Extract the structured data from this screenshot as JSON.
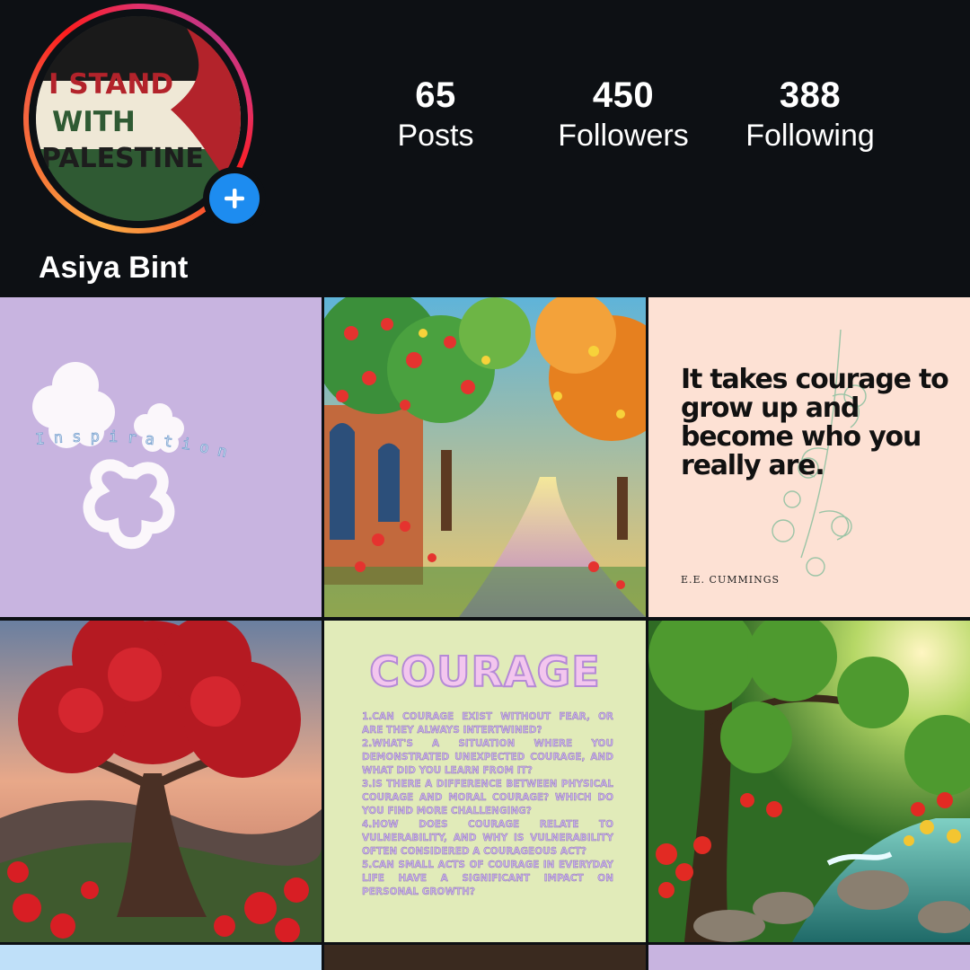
{
  "profile": {
    "username": "Asiya Bint",
    "avatar_text": [
      "I STAND",
      "WITH",
      "PALESTINE"
    ],
    "add_story_icon": "plus-icon"
  },
  "stats": [
    {
      "value": "65",
      "label": "Posts"
    },
    {
      "value": "450",
      "label": "Followers"
    },
    {
      "value": "388",
      "label": "Following"
    }
  ],
  "colors": {
    "background": "#0d1014",
    "accent_blue": "#1d8cf0",
    "ring_gradient": [
      "#fcaf45",
      "#fd1d1d",
      "#e1306c",
      "#c13584"
    ]
  },
  "posts": {
    "inspiration": {
      "word": "Inspiration",
      "bg": "#c8b4e0"
    },
    "garden_path": {
      "kind": "painting"
    },
    "quote": {
      "text": "It takes courage to grow up and become who you really are.",
      "author": "E.E. CUMMINGS",
      "bg": "#fde1d4"
    },
    "red_tree": {
      "kind": "painting"
    },
    "courage": {
      "title": "COURAGE",
      "bg": "#e1ebb9",
      "questions": [
        "1.Can courage exist without fear, or are they always intertwined?",
        "2.What's a situation where you demonstrated unexpected courage, and what did you learn from it?",
        "3.Is there a difference between physical courage and moral courage? Which do you find more challenging?",
        "4.How does courage relate to vulnerability, and why is vulnerability often considered a courageous act?",
        "5.Can small acts of courage in everyday life have a significant impact on personal growth?"
      ]
    },
    "forest_stream": {
      "kind": "painting"
    }
  }
}
